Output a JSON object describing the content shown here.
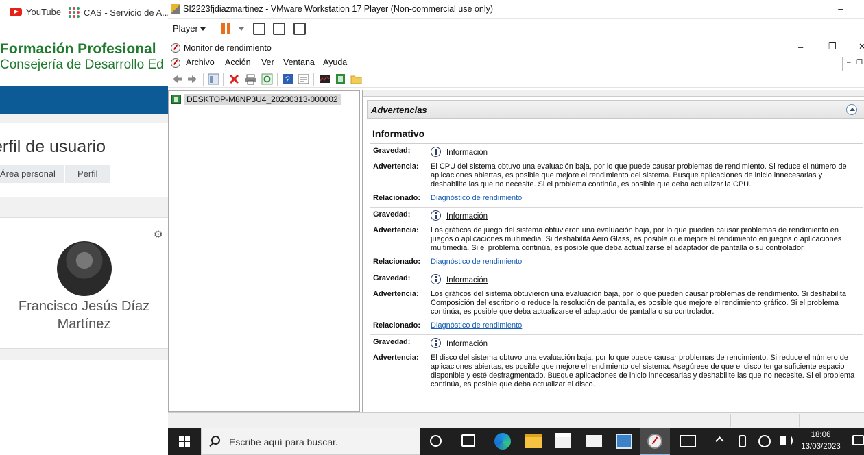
{
  "browser": {
    "bookmarks": [
      {
        "label": "YouTube",
        "icon": "youtube-icon"
      },
      {
        "label": "CAS - Servicio de A...",
        "icon": "cas-icon"
      }
    ],
    "site_title": "Formación Profesional",
    "site_subtitle": "Consejería de Desarrollo Ed",
    "page_title": "erfil de usuario",
    "breadcrumb": [
      "Área personal",
      "Perfil"
    ],
    "user_name": "Francisco Jesús Díaz Martínez",
    "colors": {
      "brand_green": "#1f7a2e",
      "nav_blue": "#0c5b96"
    }
  },
  "vmware": {
    "title": "SI2223fjdiazmartinez - VMware Workstation 17 Player (Non-commercial use only)",
    "minimize_glyph": "–",
    "player_menu": "Player",
    "toolbar_icons": [
      "pause-icon",
      "send-ctrl-alt-del-icon",
      "fullscreen-icon",
      "unity-icon"
    ]
  },
  "perfmon": {
    "window_title": "Monitor de rendimiento",
    "window_buttons": {
      "minimize": "–",
      "restore": "❐",
      "close": "✕"
    },
    "menu": [
      "Archivo",
      "Acción",
      "Ver",
      "Ventana",
      "Ayuda"
    ],
    "mdi_buttons": {
      "minimize": "–",
      "restore": "❐"
    },
    "tree": {
      "node_label": "DESKTOP-M8NP3U4_20230313-000002"
    },
    "report": {
      "section_title": "Advertencias",
      "subsection_title": "Informativo",
      "labels": {
        "severity": "Gravedad:",
        "warning": "Advertencia:",
        "related": "Relacionado:"
      },
      "warnings": [
        {
          "severity": "Información",
          "text": "El CPU del sistema obtuvo una evaluación baja, por lo que puede causar problemas de rendimiento. Si reduce el número de aplicaciones abiertas, es posible que mejore el rendimiento del sistema. Busque aplicaciones de inicio innecesarias y deshabilite las que no necesite. Si el problema continúa, es posible que deba actualizar la CPU.",
          "related": "Diagnóstico de rendimiento"
        },
        {
          "severity": "Información",
          "text": "Los gráficos de juego del sistema obtuvieron una evaluación baja, por lo que pueden causar problemas de rendimiento en juegos o aplicaciones multimedia. Si deshabilita Aero Glass, es posible que mejore el rendimiento en juegos o aplicaciones multimedia. Si el problema continúa, es posible que deba actualizarse el adaptador de pantalla o su controlador.",
          "related": "Diagnóstico de rendimiento"
        },
        {
          "severity": "Información",
          "text": "Los gráficos del sistema obtuvieron una evaluación baja, por lo que pueden causar problemas de rendimiento. Si deshabilita Composición del escritorio o reduce la resolución de pantalla, es posible que mejore el rendimiento gráfico. Si el problema continúa, es posible que deba actualizarse el adaptador de pantalla o su controlador.",
          "related": "Diagnóstico de rendimiento"
        },
        {
          "severity": "Información",
          "text": "El disco del sistema obtuvo una evaluación baja, por lo que puede causar problemas de rendimiento. Si reduce el número de aplicaciones abiertas, es posible que mejore el rendimiento del sistema. Asegúrese de que el disco tenga suficiente espacio disponible y esté desfragmentado. Busque aplicaciones de inicio innecesarias y deshabilite las que no necesite. Si el problema continúa, es posible que deba actualizar el disco."
        }
      ]
    }
  },
  "taskbar": {
    "search_placeholder": "Escribe aquí para buscar.",
    "pinned_icons": [
      "cortana-icon",
      "task-view-icon",
      "edge-icon",
      "file-explorer-icon",
      "store-icon",
      "mail-icon",
      "vmware-icon",
      "perfmon-icon",
      "news-icon"
    ],
    "time": "18:06",
    "date": "13/03/2023"
  }
}
